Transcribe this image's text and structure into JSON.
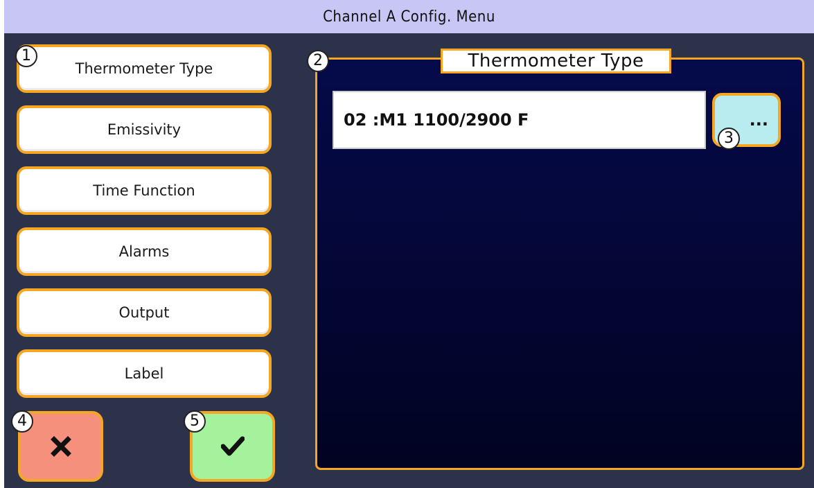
{
  "window": {
    "title": "Channel A Config. Menu"
  },
  "menu": {
    "items": [
      {
        "label": "Thermometer Type"
      },
      {
        "label": "Emissivity"
      },
      {
        "label": "Time Function"
      },
      {
        "label": "Alarms"
      },
      {
        "label": "Output"
      },
      {
        "label": "Label"
      }
    ]
  },
  "panel": {
    "title": "Thermometer Type",
    "value": "02 :M1 1100/2900 F",
    "browse_label": "..."
  },
  "actions": {
    "cancel_icon": "close-x-icon",
    "confirm_icon": "checkmark-icon"
  },
  "badges": [
    "1",
    "2",
    "3",
    "4",
    "5"
  ],
  "colors": {
    "accent": "#f5a623",
    "background": "#2b3249",
    "titlebar": "#c8c6f4",
    "panel": "#050a4a",
    "cancel": "#f5907c",
    "confirm": "#a4f39c",
    "browse": "#b9ecee"
  }
}
